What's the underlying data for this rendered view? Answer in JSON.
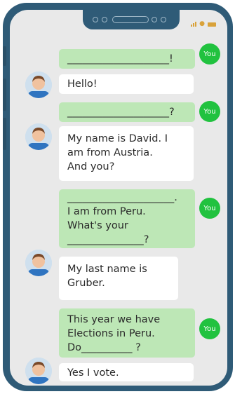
{
  "status_bar": {
    "signal_icon": "signal-icon",
    "wifi_icon": "wifi-icon",
    "battery_icon": "battery-icon"
  },
  "contact": {
    "you_label": "You"
  },
  "messages": [
    {
      "sender": "you",
      "text": "____________________!"
    },
    {
      "sender": "david",
      "text": "Hello!"
    },
    {
      "sender": "you",
      "text": "____________________?"
    },
    {
      "sender": "david",
      "lines": [
        "My name is David. I",
        "am from Austria.",
        "And you?"
      ]
    },
    {
      "sender": "you",
      "lines": [
        "_____________________.",
        "I am from Peru.",
        "What's your",
        "_______________?"
      ]
    },
    {
      "sender": "david",
      "lines": [
        "My last name is",
        "Gruber."
      ]
    },
    {
      "sender": "you",
      "lines": [
        "This year we have",
        "Elections in Peru.",
        "Do__________ ?"
      ]
    },
    {
      "sender": "david",
      "text": "Yes I vote."
    }
  ],
  "colors": {
    "frame": "#2f5b77",
    "screen": "#e9e9e9",
    "sent_bubble": "#bde7b6",
    "received_bubble": "#ffffff",
    "you_avatar": "#21c23f"
  }
}
